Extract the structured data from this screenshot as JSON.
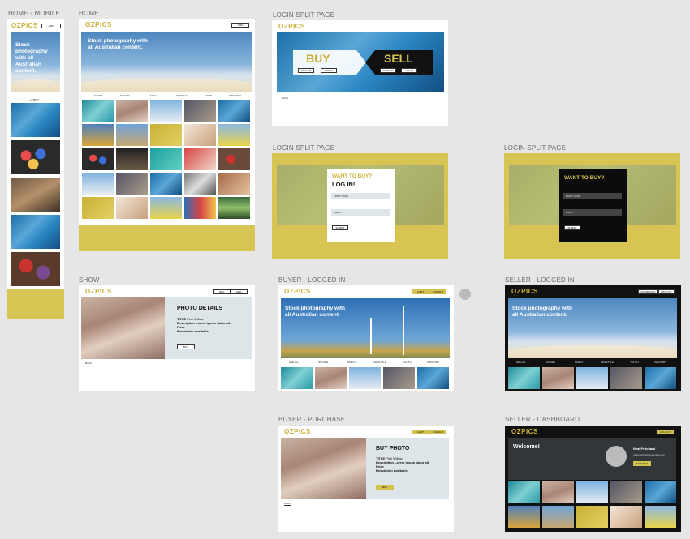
{
  "labels": {
    "home_mobile": "HOME - MOBILE",
    "home": "HOME",
    "login_split_1": "LOGIN SPLIT PAGE",
    "login_split_2": "LOGIN SPLIT PAGE",
    "login_split_3": "LOGIN SPLIT PAGE",
    "show": "SHOW",
    "buyer_logged_in": "BUYER - LOGGED IN",
    "seller_logged_in": "SELLER - LOGGED IN",
    "buyer_purchase": "BUYER - PURCHASE",
    "seller_dashboard": "SELLER - DASHBOARD"
  },
  "brand": {
    "logo": "OZPICS",
    "accent": "#d7c453"
  },
  "hero": {
    "headline": "Stock photography with all Australian content."
  },
  "mobile": {
    "headline": "Stock photography with all Australian content.",
    "join": "JOIN",
    "latest": "LATEST"
  },
  "nav": {
    "join": "JOIN",
    "buy": "BUY",
    "sell": "SELL",
    "cart": "CART",
    "log_out": "LOG OUT",
    "dashboard": "DASHBOARD",
    "back": "BACK"
  },
  "categories": [
    "LATEST",
    "NATURE",
    "FAMILY",
    "LIFESTYLE",
    "YOUTH",
    "INDUSTRY"
  ],
  "categories_loggedin": [
    "SEE ALL",
    "NATURE",
    "FAMILY",
    "LIFESTYLE",
    "YOUTH",
    "INDUSTRY"
  ],
  "split": {
    "buy": "BUY",
    "sell": "SELL",
    "sign_up": "SIGN UP",
    "login": "LOGIN"
  },
  "login": {
    "want": "WANT TO BUY?",
    "log_in": "LOG IN!",
    "first_name": "FIRST NAME",
    "email": "EMAIL",
    "submit": "SUBMIT"
  },
  "details": {
    "title": "PHOTO DETAILS",
    "title_label": "TITLE",
    "title_value": "Pink Willow",
    "description": "Description Lorem ipsum dolor sit.",
    "price": "Price",
    "resolution": "Resolution available",
    "buy": "BUY"
  },
  "purchase": {
    "title": "BUY PHOTO",
    "buy": "BUY"
  },
  "dashboard": {
    "welcome": "Welcome!",
    "name": "Neal Pritchard",
    "email": "neal.pritchard@example.com",
    "sub_button": "SUB INFO"
  }
}
